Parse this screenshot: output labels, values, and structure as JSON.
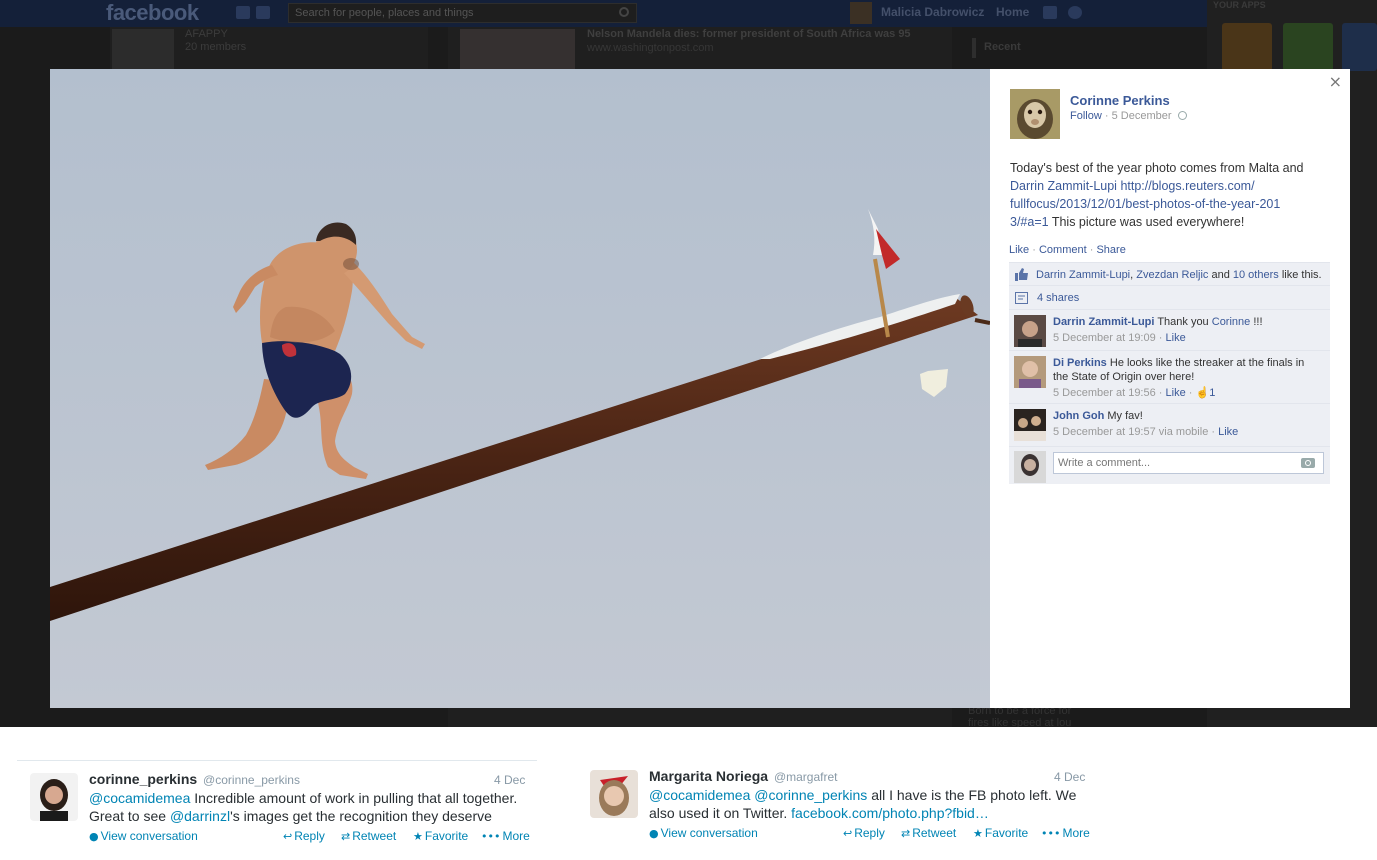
{
  "facebook_bg": {
    "logo": "facebook",
    "search_placeholder": "Search for people, places and things",
    "user_name": "Malicia Dabrowicz",
    "home_label": "Home",
    "group_name": "AFAPPY",
    "group_members": "20 members",
    "news_title": "Nelson Mandela dies: former president of South Africa was 95",
    "news_url": "www.washingtonpost.com",
    "recent_label": "Recent",
    "right_header": "YOUR APPS",
    "snippet": "Born to be a force for fires like speed at lou"
  },
  "photo_viewer": {
    "close_label": "×",
    "owner_name": "Corinne Perkins",
    "follow_label": "Follow",
    "post_date": "5 December",
    "post_text_intro": "Today's best of the year photo comes from Malta and",
    "post_tag": "Darrin Zammit-Lupi",
    "post_url_1": "http://blogs.reuters.com/",
    "post_url_2": "fullfocus/2013/12/01/best-photos-of-the-year-201",
    "post_url_3": "3/#a=1",
    "post_text_outro": "This picture was used everywhere!",
    "actions": {
      "like": "Like",
      "comment": "Comment",
      "share": "Share",
      "sep": "·"
    },
    "likes": {
      "name1": "Darrin Zammit-Lupi",
      "comma": ",",
      "name2": "Zvezdan Reljic",
      "and": "and",
      "others": "10 others",
      "suffix": "like this."
    },
    "shares": "4 shares",
    "comments": [
      {
        "author": "Darrin Zammit-Lupi",
        "text_pre": "Thank you",
        "mention": "Corinne",
        "text_post": "!!!",
        "time": "5 December at 19:09",
        "like": "Like",
        "likes": ""
      },
      {
        "author": "Di Perkins",
        "text_pre": "He looks like the streaker at the finals in the State of Origin over here!",
        "mention": "",
        "text_post": "",
        "time": "5 December at 19:56",
        "like": "Like",
        "likes": "1"
      },
      {
        "author": "John Goh",
        "text_pre": "My fav!",
        "mention": "",
        "text_post": "",
        "time": "5 December at 19:57 via mobile",
        "like": "Like",
        "likes": ""
      }
    ],
    "write_placeholder": "Write a comment..."
  },
  "tweets": [
    {
      "name": "corinne_perkins",
      "handle": "@corinne_perkins",
      "date": "4 Dec",
      "mention": "@cocamidemea",
      "text1": "Incredible amount of work in pulling that all together.",
      "text2": "Great to see",
      "mention2": "@darrinzl",
      "text3": "'s images get the recognition they deserve",
      "view": "View conversation",
      "reply": "Reply",
      "retweet": "Retweet",
      "favorite": "Favorite",
      "more": "More"
    },
    {
      "name": "Margarita Noriega",
      "handle": "@margafret",
      "date": "4 Dec",
      "mention": "@cocamidemea",
      "mention2": "@corinne_perkins",
      "text1": "all I have is the FB photo left. We",
      "text2": "also used it on Twitter.",
      "link": "facebook.com/photo.php?fbid…",
      "view": "View conversation",
      "reply": "Reply",
      "retweet": "Retweet",
      "favorite": "Favorite",
      "more": "More"
    }
  ],
  "colors": {
    "fb_blue": "#3b5998",
    "twitter_link": "#0084b4",
    "ufi_bg": "#edeff4",
    "sky": "#b8c2cf"
  }
}
